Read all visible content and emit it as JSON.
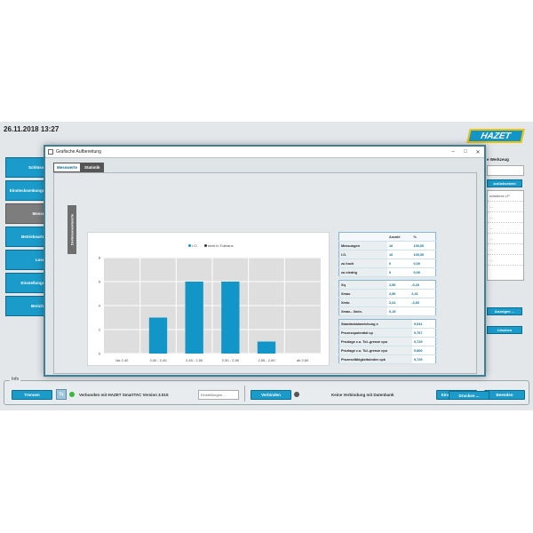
{
  "app": {
    "datetime": "26.11.2018 13:27",
    "logo": "HAZET",
    "sidebar": [
      {
        "label": "Schlüssel",
        "active": false
      },
      {
        "label": "Einstecksenkungen",
        "active": false
      },
      {
        "label": "Messen",
        "active": true
      },
      {
        "label": "Betriebsarten",
        "active": false
      },
      {
        "label": "Losen",
        "active": false
      },
      {
        "label": "Einstellungen",
        "active": false
      },
      {
        "label": "Berichte",
        "active": false
      }
    ],
    "right_panel": {
      "top_label": "e Werkzeug",
      "reset_button": "zurücksetzen",
      "list_header": "ndaderes LP",
      "list_items": [
        "....",
        "....",
        "....",
        "....",
        "....",
        "...."
      ],
      "show_button": "Anzeigen ...",
      "delete_button": "Löschen"
    }
  },
  "info_bar": {
    "label": "Info",
    "disconnect_button": "Trennen",
    "connection_text": "Verbunden mit HAZET SmartTAC Version 3.015",
    "settings_input_placeholder": "Einstellungen ...",
    "connect_button": "Verbinden",
    "db_status": "Keine Verbindung mit Datenbank",
    "settings_button": "Einstellungen ...",
    "exit_button": "Beenden"
  },
  "dialog": {
    "title": "Grafische Aufbereitung",
    "tabs": [
      {
        "label": "Messwerte",
        "active": true
      },
      {
        "label": "Statistik",
        "active": false
      }
    ],
    "vertical_tab": "Drehmomentwerte",
    "print_button": "Drucken ..."
  },
  "chart_data": {
    "type": "bar",
    "legend": [
      {
        "name": "i.O.",
        "color": "#1296c8"
      },
      {
        "name": "nicht in Toleranz",
        "color": "#333333"
      }
    ],
    "categories": [
      "bis 2,40",
      "2,40 - 2,45",
      "2,45 - 2,50",
      "2,50 - 2,55",
      "2,55 - 2,60",
      "ab 2,60"
    ],
    "values": [
      0,
      3,
      6,
      6,
      1,
      0
    ],
    "ylim": [
      0,
      8
    ],
    "yticks": [
      0,
      2,
      4,
      6,
      8
    ],
    "bar_color": "#1296c8"
  },
  "stats": {
    "counts": {
      "headers": [
        "",
        "Anzahl",
        "%"
      ],
      "rows": [
        [
          "Messungen",
          "16",
          "100,00"
        ],
        [
          "I.O.",
          "16",
          "100,00"
        ],
        [
          "zu hoch",
          "0",
          "0,00"
        ],
        [
          "zu niedrig",
          "0",
          "0,00"
        ]
      ]
    },
    "values": [
      [
        "Xq",
        "2,50",
        "-0,20"
      ],
      [
        "Xmax.",
        "2,56",
        "2,41"
      ],
      [
        "Xmin.",
        "2,41",
        "-3,60"
      ],
      [
        "Xmax.- Xmin.",
        "0,15",
        ""
      ]
    ],
    "capability": [
      [
        "Standardabweichung s",
        "0,041"
      ],
      [
        "Prozesspotential cp",
        "0,767"
      ],
      [
        "Prozlage z.u. Tol.-grenze cpu",
        "0,729"
      ],
      [
        "Prozlage z.u. Tol.-grenze cpo",
        "0,800"
      ],
      [
        "Prozessfähigkeitsindex cpk",
        "0,729"
      ]
    ]
  }
}
